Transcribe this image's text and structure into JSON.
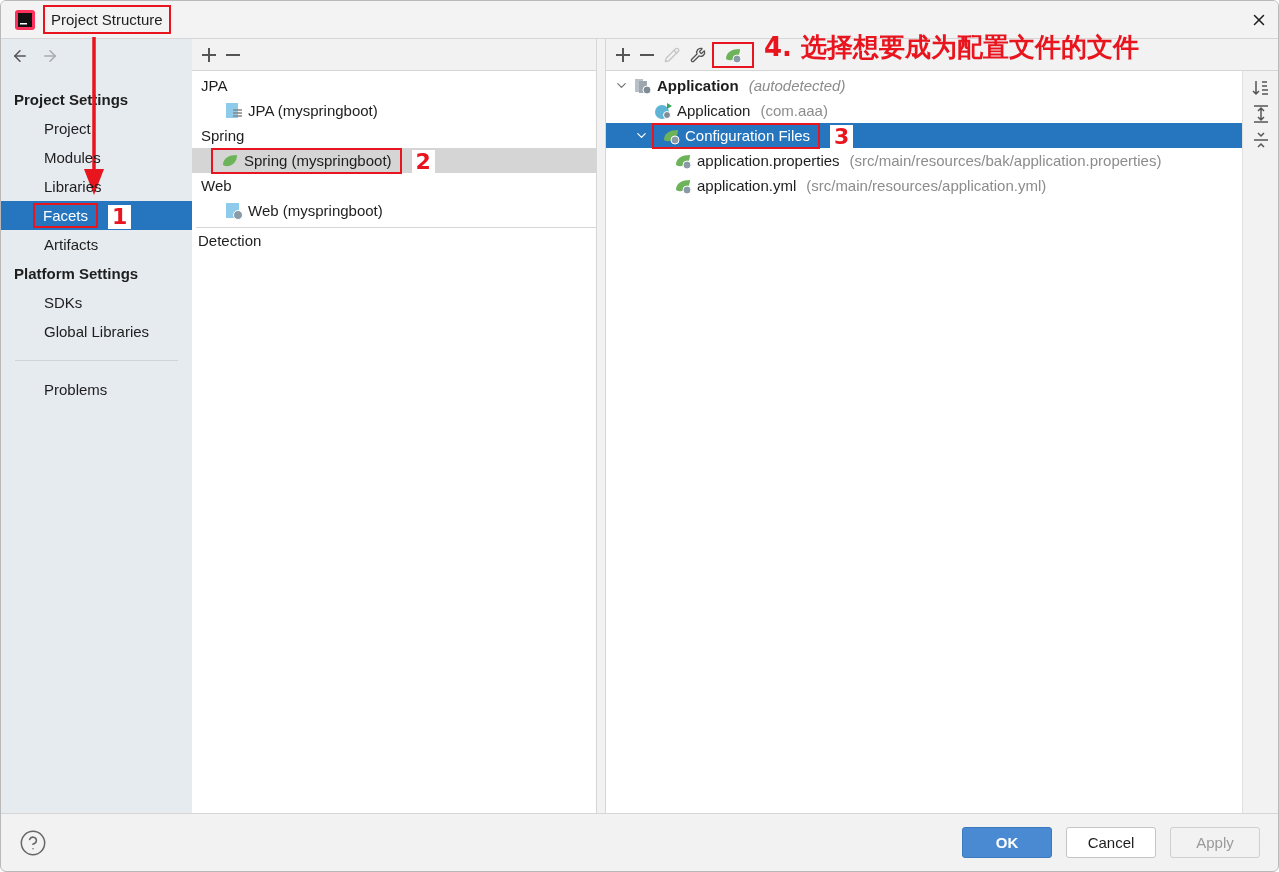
{
  "window": {
    "title": "Project Structure",
    "annotated": true
  },
  "sidebar": {
    "groups": [
      {
        "heading": "Project Settings",
        "items": [
          {
            "label": "Project",
            "selected": false,
            "annotated": false
          },
          {
            "label": "Modules",
            "selected": false,
            "annotated": false
          },
          {
            "label": "Libraries",
            "selected": false,
            "annotated": false
          },
          {
            "label": "Facets",
            "selected": true,
            "annotated": true,
            "callout": "1"
          },
          {
            "label": "Artifacts",
            "selected": false,
            "annotated": false
          }
        ]
      },
      {
        "heading": "Platform Settings",
        "items": [
          {
            "label": "SDKs",
            "selected": false,
            "annotated": false
          },
          {
            "label": "Global Libraries",
            "selected": false,
            "annotated": false
          }
        ]
      }
    ],
    "extra_items": [
      {
        "label": "Problems",
        "selected": false,
        "annotated": false
      }
    ]
  },
  "facets": {
    "groups": [
      {
        "heading": "JPA",
        "items": [
          {
            "label": "JPA (myspringboot)",
            "kind": "jpa",
            "selected": false,
            "annotated": false
          }
        ]
      },
      {
        "heading": "Spring",
        "items": [
          {
            "label": "Spring (myspringboot)",
            "kind": "spring",
            "selected": true,
            "annotated": true,
            "callout": "2"
          }
        ]
      },
      {
        "heading": "Web",
        "items": [
          {
            "label": "Web (myspringboot)",
            "kind": "web",
            "selected": false,
            "annotated": false
          }
        ]
      }
    ],
    "detection": "Detection"
  },
  "details": {
    "toolbar": [
      {
        "kind": "add",
        "disabled": false,
        "annotated": false
      },
      {
        "kind": "remove",
        "disabled": false,
        "annotated": false
      },
      {
        "kind": "edit",
        "disabled": true,
        "annotated": false
      },
      {
        "kind": "settings",
        "disabled": false,
        "annotated": false
      },
      {
        "kind": "fileset",
        "disabled": false,
        "annotated": true,
        "callout": "4. 选择想要成为配置文件的文件"
      }
    ],
    "tree": [
      {
        "kind": "facet",
        "label": "Application",
        "hint": "(autodetected)",
        "expanded": true,
        "selected": false,
        "annotated": false,
        "children": [
          {
            "kind": "class",
            "label": "Application",
            "hint": "(com.aaa)",
            "selected": false,
            "annotated": false
          },
          {
            "kind": "fileset",
            "label": "Configuration Files",
            "expanded": true,
            "selected": true,
            "annotated": true,
            "callout": "3",
            "children": [
              {
                "kind": "file",
                "label": "application.properties",
                "hint": "(src/main/resources/bak/application.properties)",
                "selected": false,
                "annotated": false
              },
              {
                "kind": "file",
                "label": "application.yml",
                "hint": "(src/main/resources/application.yml)",
                "selected": false,
                "annotated": false
              }
            ]
          }
        ]
      }
    ]
  },
  "buttons": [
    {
      "label": "OK",
      "kind": "primary",
      "disabled": false
    },
    {
      "label": "Cancel",
      "kind": "normal",
      "disabled": false
    },
    {
      "label": "Apply",
      "kind": "normal",
      "disabled": true
    }
  ]
}
